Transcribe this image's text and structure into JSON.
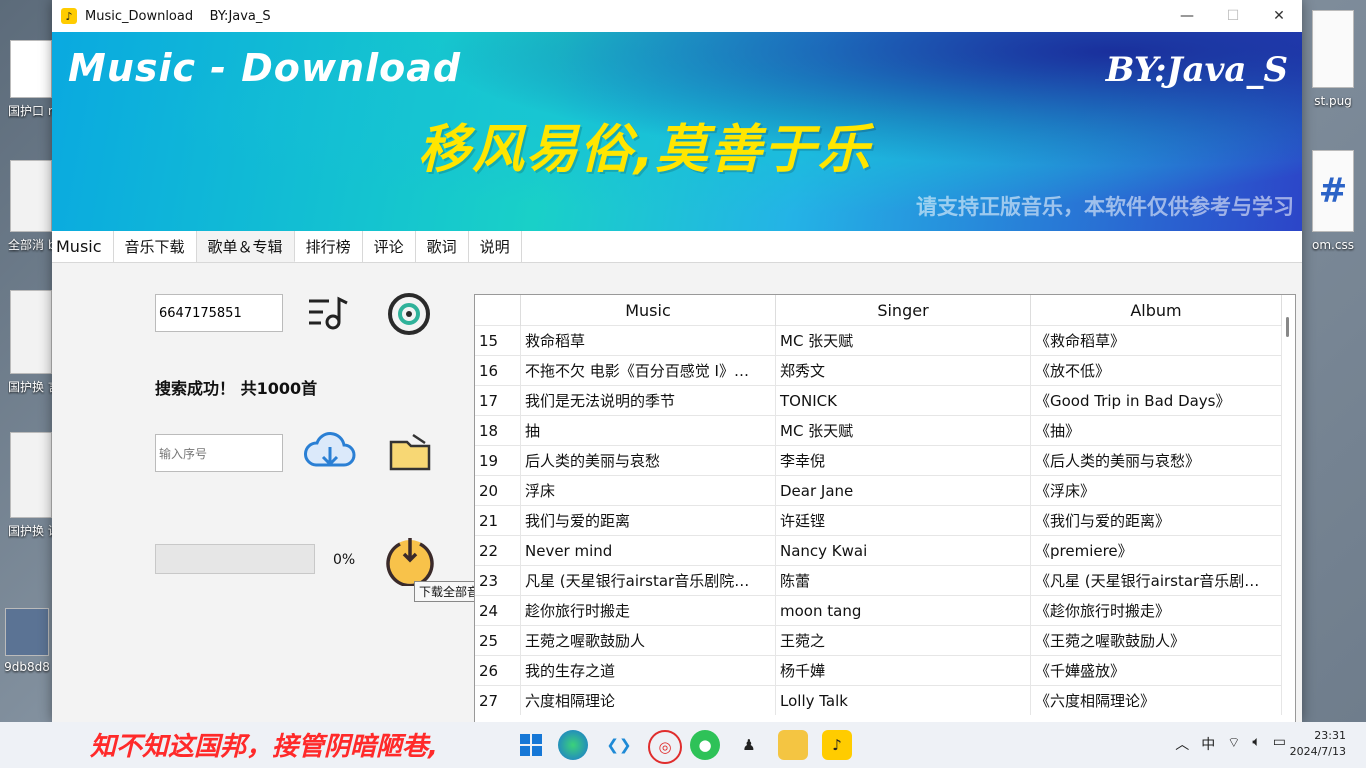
{
  "desktop": {
    "icons": [
      {
        "label": "国护口 m"
      },
      {
        "label": "全部消 ba"
      },
      {
        "label": "国护换 言稿."
      },
      {
        "label": "国护换 讲稿_张"
      },
      {
        "label": "9db8d8"
      },
      {
        "label": "st.pug"
      },
      {
        "label": "om.css"
      }
    ]
  },
  "window": {
    "title": "Music_Download    BY:Java_S",
    "app_icon": "music-note-icon",
    "controls": {
      "minimize": "—",
      "maximize": "☐",
      "close": "✕"
    }
  },
  "banner": {
    "title": "Music - Download",
    "by": "BY:Java_S",
    "slogan": "移风易俗,莫善于乐",
    "note": "请支持正版音乐，本软件仅供参考与学习"
  },
  "tabs": [
    {
      "label": "Music"
    },
    {
      "label": "音乐下载"
    },
    {
      "label": "歌单＆专辑"
    },
    {
      "label": "排行榜"
    },
    {
      "label": "评论"
    },
    {
      "label": "歌词"
    },
    {
      "label": "说明"
    }
  ],
  "active_tab": "歌单＆专辑",
  "panel": {
    "playlist_id_value": "6647175851",
    "status": "搜索成功！ 共1000首",
    "index_placeholder": "输入序号",
    "progress_percent": 0,
    "progress_label": "0%",
    "tooltip": "下载全部音乐"
  },
  "table": {
    "headers": {
      "music": "Music",
      "singer": "Singer",
      "album": "Album"
    },
    "rows": [
      {
        "idx": "15",
        "music": "救命稻草",
        "singer": "MC 张天赋",
        "album": "《救命稻草》"
      },
      {
        "idx": "16",
        "music": "不拖不欠 电影《百分百感觉 I》…",
        "singer": "郑秀文",
        "album": "《放不低》"
      },
      {
        "idx": "17",
        "music": "我们是无法说明的季节",
        "singer": "TONICK",
        "album": "《Good Trip in Bad Days》"
      },
      {
        "idx": "18",
        "music": "抽",
        "singer": "MC 张天赋",
        "album": "《抽》"
      },
      {
        "idx": "19",
        "music": "后人类的美丽与哀愁",
        "singer": "李幸倪",
        "album": "《后人类的美丽与哀愁》"
      },
      {
        "idx": "20",
        "music": "浮床",
        "singer": "Dear Jane",
        "album": "《浮床》"
      },
      {
        "idx": "21",
        "music": "我们与爱的距离",
        "singer": "许廷铿",
        "album": "《我们与爱的距离》"
      },
      {
        "idx": "22",
        "music": "Never mind",
        "singer": "Nancy Kwai",
        "album": "《premiere》"
      },
      {
        "idx": "23",
        "music": "凡星 (天星银行airstar音乐剧院…",
        "singer": "陈蕾",
        "album": "《凡星 (天星银行airstar音乐剧…"
      },
      {
        "idx": "24",
        "music": "趁你旅行时搬走",
        "singer": "moon tang",
        "album": "《趁你旅行时搬走》"
      },
      {
        "idx": "25",
        "music": "王菀之喔歌鼓励人",
        "singer": "王菀之",
        "album": "《王菀之喔歌鼓励人》"
      },
      {
        "idx": "26",
        "music": "我的生存之道",
        "singer": "杨千嬅",
        "album": "《千嬅盛放》"
      },
      {
        "idx": "27",
        "music": "六度相隔理论",
        "singer": "Lolly Talk",
        "album": "《六度相隔理论》"
      }
    ]
  },
  "taskbar": {
    "lyric": "知不知这国邦，接管阴暗陋巷,",
    "apps": [
      "windows-start-icon",
      "edge-icon",
      "vscode-icon",
      "netease-music-icon",
      "wechat-icon",
      "qq-icon",
      "file-explorer-icon",
      "music-download-icon"
    ],
    "tray_ime": "中",
    "time": "23:31",
    "date": "2024/7/13"
  }
}
